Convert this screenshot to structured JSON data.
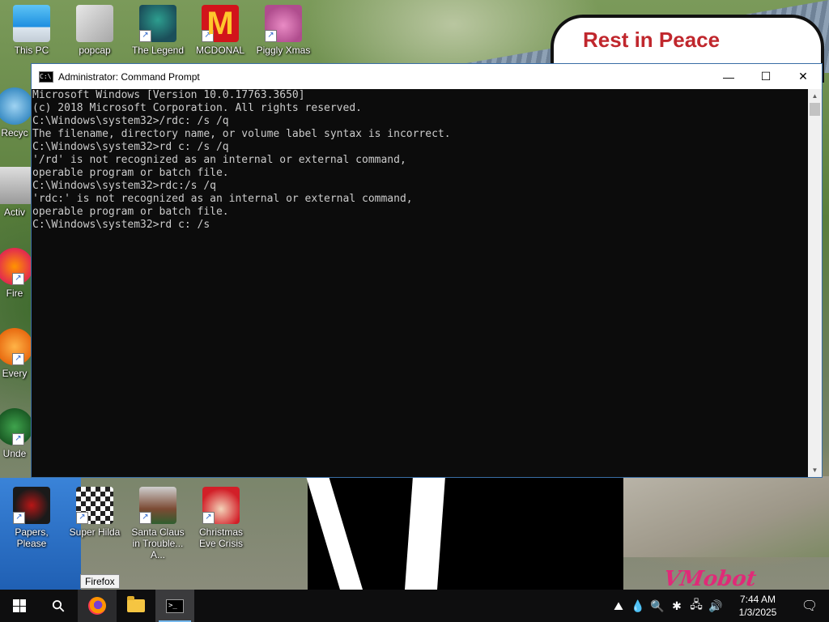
{
  "wallpaper": {
    "memorial_title": "Rest in Peace",
    "watermark": "VMobot"
  },
  "desktop": {
    "icons_top": [
      {
        "label": "This PC",
        "icon": "this-pc-icon"
      },
      {
        "label": "popcap",
        "icon": "popcap-icon"
      },
      {
        "label": "The Legend",
        "icon": "legend-game-icon"
      },
      {
        "label": "MCDONAL",
        "icon": "mcdonalds-icon"
      },
      {
        "label": "Piggly Xmas",
        "icon": "piggly-xmas-icon"
      }
    ],
    "icons_left": [
      {
        "label": "Recyc",
        "icon": "recycle-bin-icon"
      },
      {
        "label": "Activ",
        "icon": "active-icon"
      },
      {
        "label": "Fire",
        "icon": "firefox-icon"
      },
      {
        "label": "Every",
        "icon": "everything-icon"
      },
      {
        "label": "Unde",
        "icon": "undertale-icon"
      }
    ],
    "icons_bottom": [
      {
        "label": "Papers, Please",
        "icon": "papers-please-icon"
      },
      {
        "label": "Super Hilda",
        "icon": "super-hilda-icon"
      },
      {
        "label": "Santa Claus in Trouble... A...",
        "icon": "santa-claus-trouble-icon"
      },
      {
        "label": "Christmas Eve Crisis",
        "icon": "christmas-eve-crisis-icon"
      }
    ]
  },
  "cmd_window": {
    "title": "Administrator: Command Prompt",
    "minimize_symbol": "—",
    "maximize_symbol": "☐",
    "close_symbol": "✕",
    "lines": [
      "Microsoft Windows [Version 10.0.17763.3650]",
      "(c) 2018 Microsoft Corporation. All rights reserved.",
      "",
      "C:\\Windows\\system32>/rdc: /s /q",
      "The filename, directory name, or volume label syntax is incorrect.",
      "",
      "C:\\Windows\\system32>rd c: /s /q",
      "'/rd' is not recognized as an internal or external command,",
      "operable program or batch file.",
      "",
      "C:\\Windows\\system32>rdc:/s /q",
      "'rdc:' is not recognized as an internal or external command,",
      "operable program or batch file.",
      "",
      "C:\\Windows\\system32>rd c: /s"
    ]
  },
  "tooltip": {
    "text": "Firefox"
  },
  "taskbar": {
    "start_icon": "windows-logo-icon",
    "search_symbol": "⚲",
    "pinned": [
      {
        "name": "Firefox",
        "icon": "firefox-icon"
      },
      {
        "name": "File Explorer",
        "icon": "folder-icon"
      },
      {
        "name": "Command Prompt",
        "icon": "cmd-icon"
      }
    ],
    "tray_symbols": [
      "⛰",
      "💧",
      "🔍",
      "✱",
      "🖧",
      "🔊"
    ],
    "time": "7:44 AM",
    "date": "1/3/2025",
    "notification_symbol": "🗨"
  }
}
